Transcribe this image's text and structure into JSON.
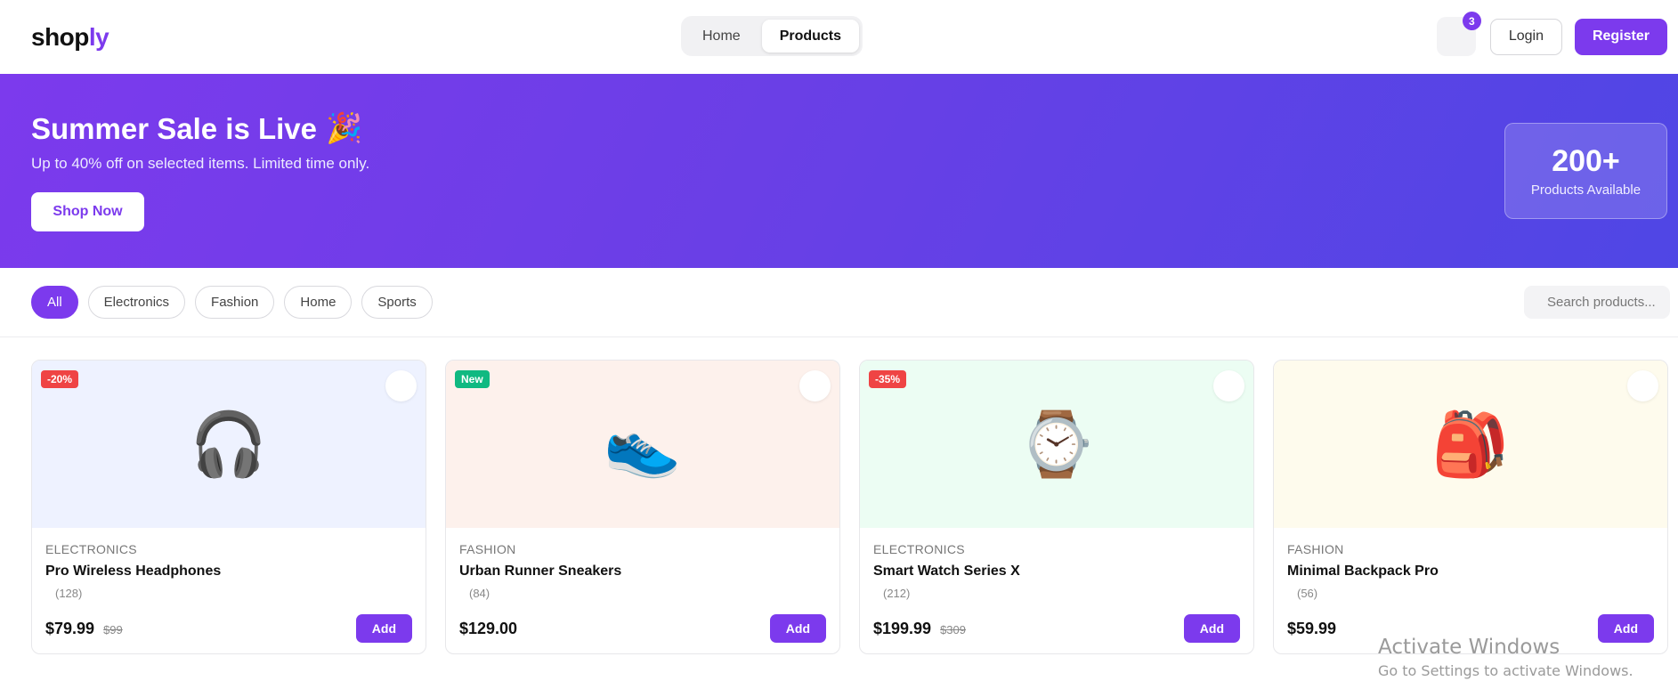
{
  "header": {
    "logo_main": "shop",
    "logo_accent": "ly",
    "nav": [
      {
        "label": "Home",
        "active": false
      },
      {
        "label": "Products",
        "active": true
      }
    ],
    "cart_count": "3",
    "login_label": "Login",
    "register_label": "Register"
  },
  "hero": {
    "title": "Summer Sale is Live",
    "emoji": "🎉",
    "subtitle": "Up to 40% off on selected items. Limited time only.",
    "cta_label": "Shop Now",
    "stat_value": "200+",
    "stat_label": "Products Available"
  },
  "filters": {
    "chips": [
      {
        "label": "All",
        "active": true
      },
      {
        "label": "Electronics",
        "active": false
      },
      {
        "label": "Fashion",
        "active": false
      },
      {
        "label": "Home",
        "active": false
      },
      {
        "label": "Sports",
        "active": false
      }
    ],
    "search_placeholder": "Search products..."
  },
  "products": [
    {
      "badge": "-20%",
      "badge_color": "#ef4444",
      "bg": "#eef2ff",
      "emoji": "🎧",
      "icon": "headphones-icon",
      "category": "Electronics",
      "name": "Pro Wireless Headphones",
      "reviews": "(128)",
      "price": "$79.99",
      "old_price": "$99",
      "add_label": "Add"
    },
    {
      "badge": "New",
      "badge_color": "#10b981",
      "bg": "#fdf1ec",
      "emoji": "👟",
      "icon": "sneaker-icon",
      "category": "Fashion",
      "name": "Urban Runner Sneakers",
      "reviews": "(84)",
      "price": "$129.00",
      "old_price": "",
      "add_label": "Add"
    },
    {
      "badge": "-35%",
      "badge_color": "#ef4444",
      "bg": "#ecfdf3",
      "emoji": "⌚",
      "icon": "watch-icon",
      "category": "Electronics",
      "name": "Smart Watch Series X",
      "reviews": "(212)",
      "price": "$199.99",
      "old_price": "$309",
      "add_label": "Add"
    },
    {
      "badge": "",
      "badge_color": "",
      "bg": "#fefbed",
      "emoji": "🎒",
      "icon": "backpack-icon",
      "category": "Fashion",
      "name": "Minimal Backpack Pro",
      "reviews": "(56)",
      "price": "$59.99",
      "old_price": "",
      "add_label": "Add"
    }
  ],
  "watermark": {
    "title": "Activate Windows",
    "subtitle": "Go to Settings to activate Windows."
  },
  "colors": {
    "accent": "#7c3aed",
    "hero_gradient_start": "#7c3aed",
    "hero_gradient_end": "#4f46e5"
  }
}
